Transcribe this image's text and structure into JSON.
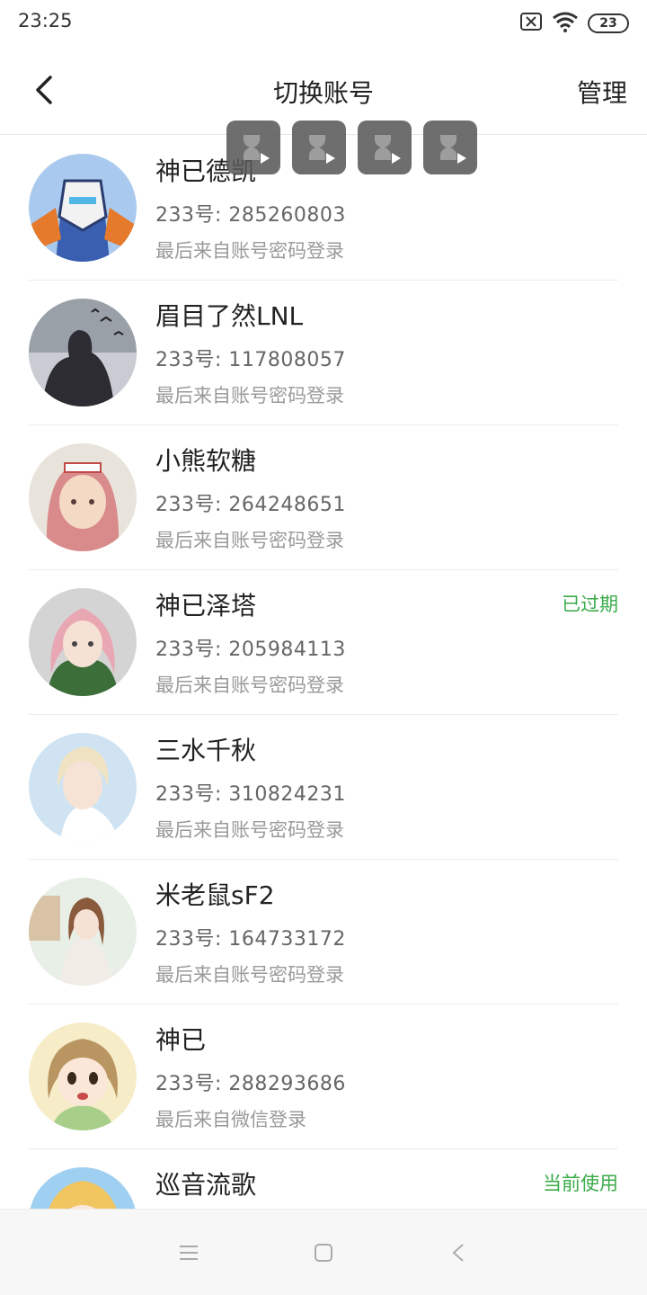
{
  "status_bar": {
    "time": "23:25",
    "battery": "23",
    "icons": [
      "sim-off-icon",
      "wifi-icon",
      "battery-icon"
    ]
  },
  "header": {
    "title": "切换账号",
    "manage_label": "管理",
    "back_icon": "chevron-left-icon"
  },
  "overlay": {
    "icon": "hourglass-play-icon",
    "count": 4
  },
  "accounts": [
    {
      "name": "神已德凯",
      "uid": "233号: 285260803",
      "login": "最后来自账号密码登录",
      "badge": "",
      "avatar_colors": [
        "#a9c9ee",
        "#e57a2c",
        "#3a5fb0"
      ]
    },
    {
      "name": "眉目了然LNL",
      "uid": "233号: 117808057",
      "login": "最后来自账号密码登录",
      "badge": "",
      "avatar_colors": [
        "#9aa0a8",
        "#2c2c32",
        "#c9ccd2"
      ]
    },
    {
      "name": "小熊软糖",
      "uid": "233号: 264248651",
      "login": "最后来自账号密码登录",
      "badge": "",
      "avatar_colors": [
        "#e8e4dc",
        "#d98a8a",
        "#f4d9c4"
      ]
    },
    {
      "name": "神已泽塔",
      "uid": "233号: 205984113",
      "login": "最后来自账号密码登录",
      "badge": "已过期",
      "avatar_colors": [
        "#d4d4d4",
        "#e9a7b3",
        "#3c6e3a"
      ]
    },
    {
      "name": "三水千秋",
      "uid": "233号: 310824231",
      "login": "最后来自账号密码登录",
      "badge": "",
      "avatar_colors": [
        "#cfe3f2",
        "#efe3c4",
        "#ffffff"
      ]
    },
    {
      "name": "米老鼠sF2",
      "uid": "233号: 164733172",
      "login": "最后来自账号密码登录",
      "badge": "",
      "avatar_colors": [
        "#e7efe6",
        "#8a5a3c",
        "#f2ece6"
      ]
    },
    {
      "name": "神已",
      "uid": "233号: 288293686",
      "login": "最后来自微信登录",
      "badge": "",
      "avatar_colors": [
        "#f6edc8",
        "#b99562",
        "#a8cf8a"
      ]
    },
    {
      "name": "巡音流歌",
      "uid": "",
      "login": "",
      "badge": "当前使用",
      "avatar_colors": [
        "#9fd0f2",
        "#f1c560",
        "#4a90d9"
      ]
    }
  ],
  "nav_bar": {
    "icons": [
      "menu-icon",
      "home-square-icon",
      "back-triangle-icon"
    ]
  },
  "colors": {
    "accent": "#3bab4a",
    "text": "#222222",
    "secondary": "#9a9a9a"
  }
}
